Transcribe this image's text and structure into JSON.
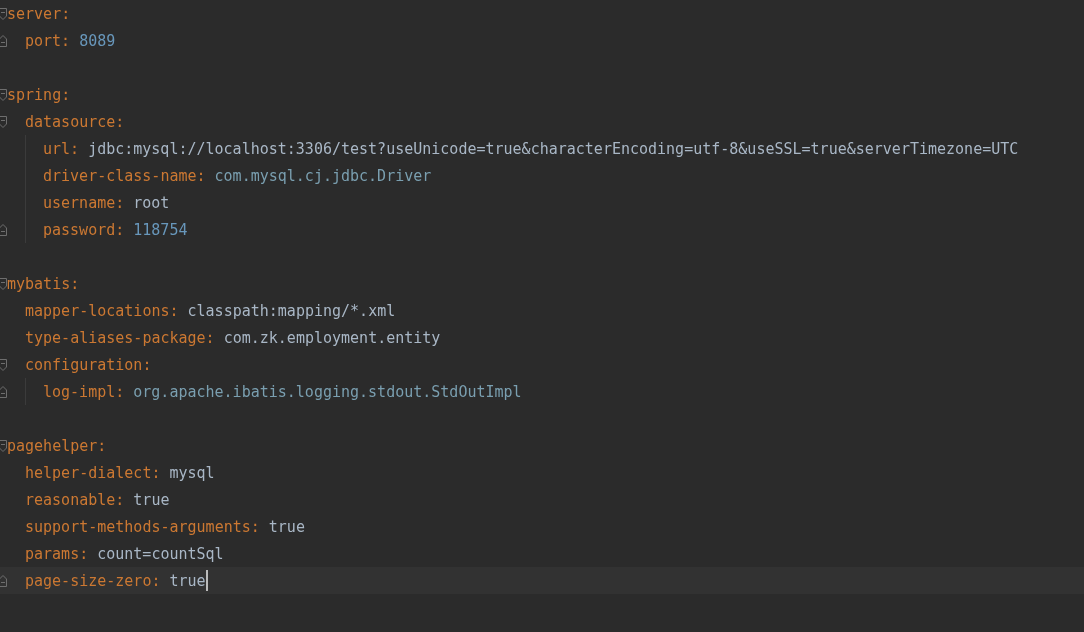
{
  "editor": {
    "document": [
      {
        "key": "server:",
        "current": false,
        "children": [
          {
            "key": "port:",
            "value": "8089",
            "kind": "number",
            "current": false
          }
        ]
      },
      {
        "key": "spring:",
        "current": false,
        "children": [
          {
            "key": "datasource:",
            "current": false,
            "children": [
              {
                "key": "url:",
                "value": "jdbc:mysql://localhost:3306/test?useUnicode=true&characterEncoding=utf-8&useSSL=true&serverTimezone=UTC",
                "kind": "text",
                "current": false
              },
              {
                "key": "driver-class-name:",
                "value": "com.mysql.cj.jdbc.Driver",
                "kind": "class_name",
                "current": false
              },
              {
                "key": "username:",
                "value": "root",
                "kind": "text",
                "current": false
              },
              {
                "key": "password:",
                "value": "118754",
                "kind": "number",
                "current": false
              }
            ]
          }
        ]
      },
      {
        "key": "mybatis:",
        "current": false,
        "children": [
          {
            "key": "mapper-locations:",
            "value": "classpath:mapping/*.xml",
            "kind": "text",
            "current": false
          },
          {
            "key": "type-aliases-package:",
            "value": "com.zk.employment.entity",
            "kind": "text",
            "current": false
          },
          {
            "key": "configuration:",
            "current": false,
            "children": [
              {
                "key": "log-impl:",
                "value": "org.apache.ibatis.logging.stdout.StdOutImpl",
                "kind": "class_name",
                "current": false
              }
            ]
          }
        ]
      },
      {
        "key": "pagehelper:",
        "current": false,
        "children": [
          {
            "key": "helper-dialect:",
            "value": "mysql",
            "kind": "text",
            "current": false
          },
          {
            "key": "reasonable:",
            "value": "true",
            "kind": "text",
            "current": false
          },
          {
            "key": "support-methods-arguments:",
            "value": "true",
            "kind": "text",
            "current": false
          },
          {
            "key": "params:",
            "value": "count=countSql",
            "kind": "text",
            "current": false
          },
          {
            "key": "page-size-zero:",
            "value": "true",
            "kind": "text",
            "current": true
          }
        ]
      }
    ]
  }
}
